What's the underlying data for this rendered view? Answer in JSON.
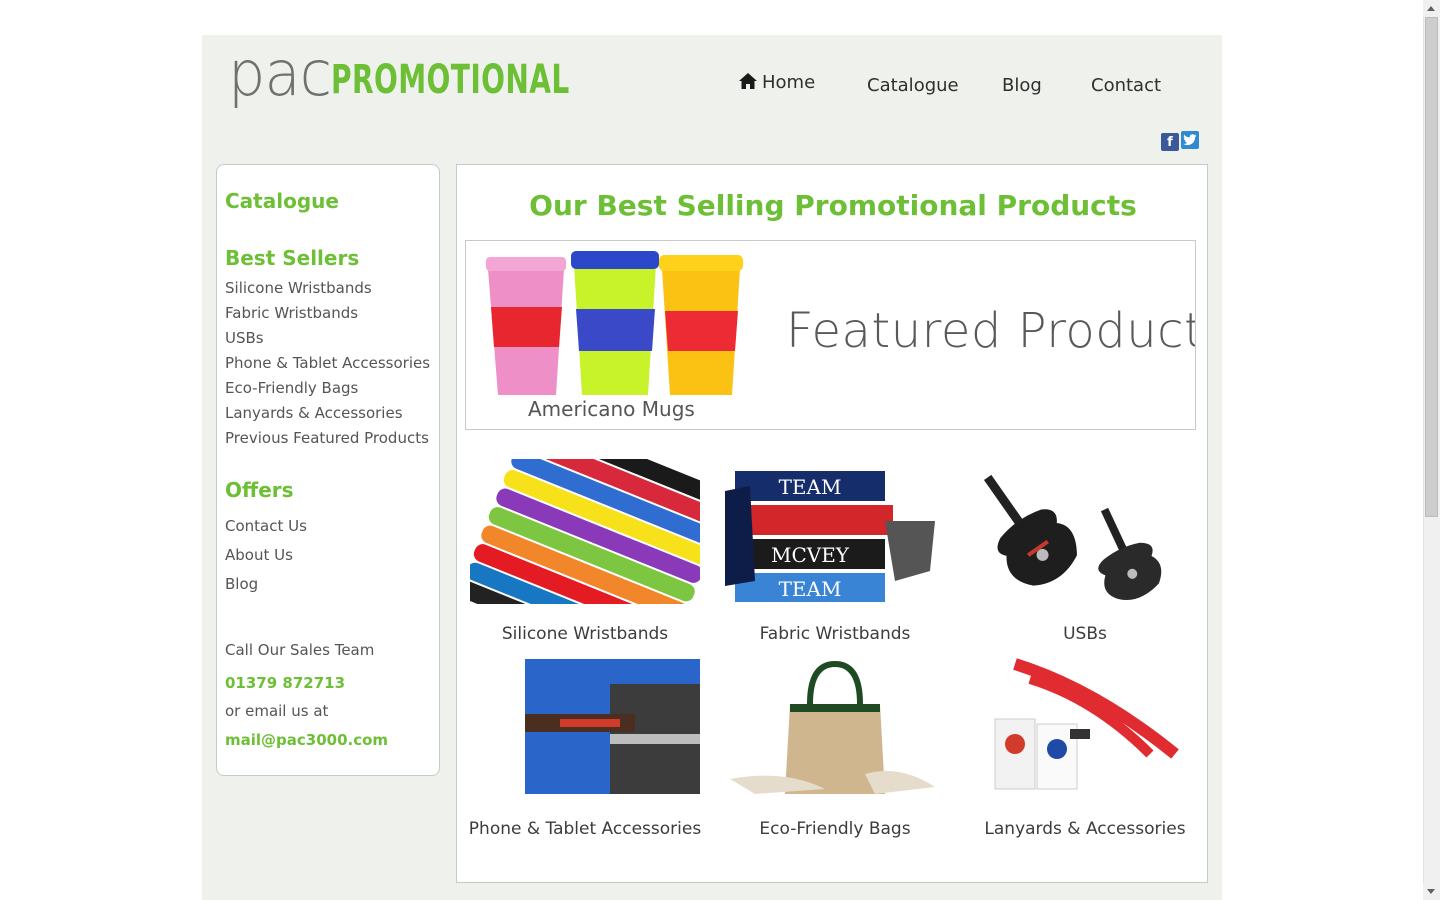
{
  "brand": {
    "logo_part1": "pac",
    "logo_part2": "PROMOTIONAL",
    "accent": "#6dbf36"
  },
  "nav": {
    "home": "Home",
    "catalogue": "Catalogue",
    "blog": "Blog",
    "contact": "Contact"
  },
  "social": {
    "facebook": "f",
    "twitter": "t"
  },
  "sidebar": {
    "catalogue_heading": "Catalogue",
    "best_sellers_heading": "Best Sellers",
    "best_sellers": [
      "Silicone Wristbands",
      "Fabric Wristbands",
      "USBs",
      "Phone & Tablet Accessories",
      "Eco-Friendly Bags",
      "Lanyards & Accessories",
      "Previous Featured Products"
    ],
    "offers_heading": "Offers",
    "links": [
      "Contact Us",
      "About Us",
      "Blog"
    ],
    "call_label": "Call Our Sales Team",
    "phone": "01379 872713",
    "email_label": "or email us at",
    "email": "mail@pac3000.com"
  },
  "main": {
    "title": "Our Best Selling Promotional Products",
    "featured_title": "Featured Product",
    "featured_name": "Americano Mugs",
    "products": [
      "Silicone Wristbands",
      "Fabric Wristbands",
      "USBs",
      "Phone & Tablet Accessories",
      "Eco-Friendly Bags",
      "Lanyards & Accessories"
    ]
  }
}
